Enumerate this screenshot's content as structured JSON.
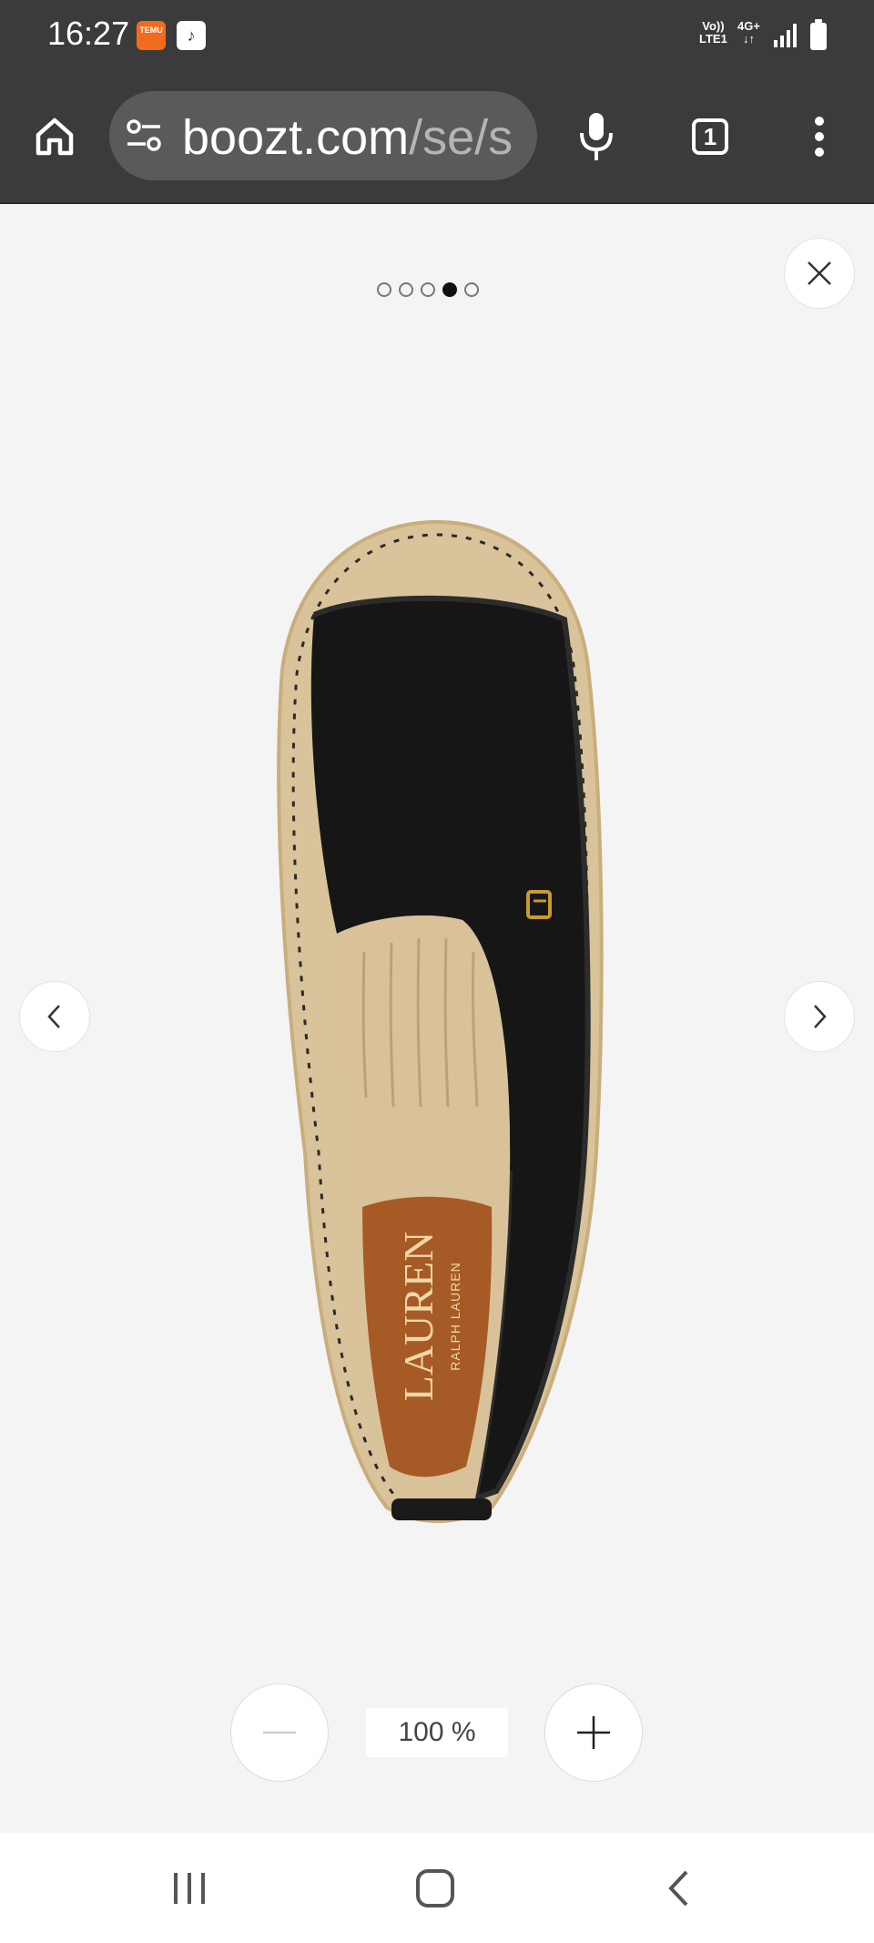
{
  "status_bar": {
    "time": "16:27",
    "app_icons": [
      {
        "name": "temu-app-icon",
        "text": "TEMU"
      },
      {
        "name": "notification-app-icon",
        "text": ""
      }
    ],
    "network": {
      "volte": "Vo))",
      "lte": "LTE1",
      "gen": "4G+",
      "arrows": "↓↑"
    }
  },
  "browser": {
    "url_domain": "boozt.com",
    "url_path": "/se/s"
  },
  "carousel": {
    "total_images": 5,
    "active_index": 3
  },
  "product_image": {
    "insole_brand": "LAUREN",
    "insole_subbrand": "RALPH LAUREN",
    "alt": "Black leather espadrille, top view"
  },
  "zoom": {
    "level": "100 %"
  },
  "colors": {
    "chrome_bar": "#3b3b3b",
    "viewer_bg": "#f4f4f4",
    "active_dot": "#111111"
  }
}
